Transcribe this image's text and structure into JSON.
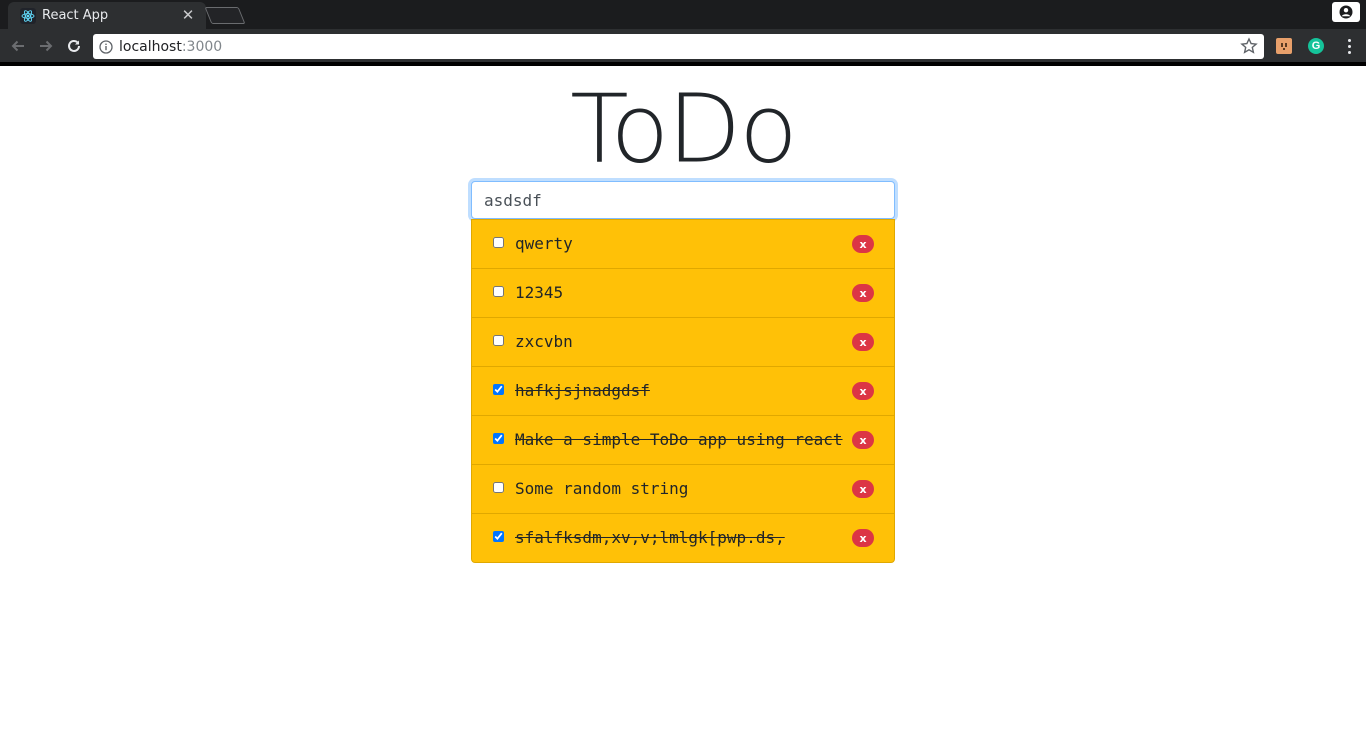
{
  "browser": {
    "tab_title": "React App",
    "tab_close": "✕",
    "url_host": "localhost",
    "url_port": ":3000"
  },
  "app": {
    "title": "ToDo",
    "input_value": "asdsdf",
    "delete_label": "x",
    "todos": [
      {
        "text": "qwerty",
        "done": false
      },
      {
        "text": "12345",
        "done": false
      },
      {
        "text": "zxcvbn",
        "done": false
      },
      {
        "text": "hafkjsjnadgdsf",
        "done": true
      },
      {
        "text": "Make a simple ToDo app using react",
        "done": true
      },
      {
        "text": "Some random string",
        "done": false
      },
      {
        "text": "sfalfksdm,xv,v;lmlgk[pwp.ds,",
        "done": true
      }
    ]
  },
  "colors": {
    "list_background": "#ffc107",
    "delete_badge": "#dc3545",
    "input_focus": "#80bdff"
  }
}
